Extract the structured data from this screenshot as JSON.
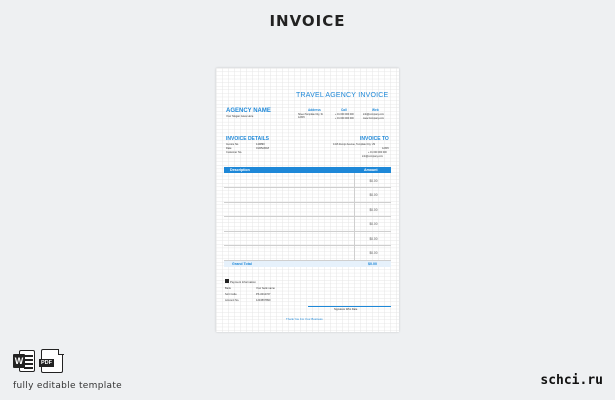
{
  "page_title": "INVOICE",
  "invoice": {
    "title": "TRAVEL AGENCY INVOICE",
    "agency_name": "AGENCY NAME",
    "agency_tagline": "Your Slogan Goes Here",
    "address_header": "Address",
    "address_value": "Street Template City, St 12345",
    "call_header": "Call",
    "call_values": [
      "+ 01 000 000 000",
      "+ 01 000 000 000"
    ],
    "web_header": "Web",
    "web_values": [
      "info@company.com",
      "www.Company.com"
    ],
    "details_header": "INVOICE DETAILS",
    "details_rows": [
      {
        "label": "Invoice No.",
        "value": "140890"
      },
      {
        "label": "Date",
        "value": "01/05/2018"
      },
      {
        "label": "Customer No.",
        "value": ""
      }
    ],
    "invoice_to_header": "INVOICE TO",
    "invoice_to_lines": [
      "1416 Zenojo Avenue, Template City, US",
      "12345",
      "+ 01 000 000 000",
      "info@company.com"
    ],
    "table_headers": {
      "description": "Description",
      "amount": "Amount"
    },
    "amounts": [
      "$0.00",
      "$0.00",
      "$0.00",
      "$0.00",
      "$0.00",
      "$0.00"
    ],
    "grand_total_label": "Grand Total",
    "grand_total_value": "$0.00",
    "payment_header": "Payment Information",
    "payment_rows": [
      {
        "label": "Bank",
        "value": "Your bank name"
      },
      {
        "label": "Sort Code",
        "value": "PK-0012727"
      },
      {
        "label": "Account No.",
        "value": "1234567890"
      }
    ],
    "signature_label": "Signature Who Date",
    "thank_you": "Thank You For Your Business"
  },
  "footer": {
    "word_icon_letter": "W",
    "pdf_icon_label": "PDF",
    "caption": "fully editable template",
    "brand": "schci.ru"
  },
  "colors": {
    "accent": "#1e88d8",
    "background": "#eef0f2",
    "text": "#222222"
  },
  "icons": [
    "word-icon",
    "pdf-icon"
  ]
}
